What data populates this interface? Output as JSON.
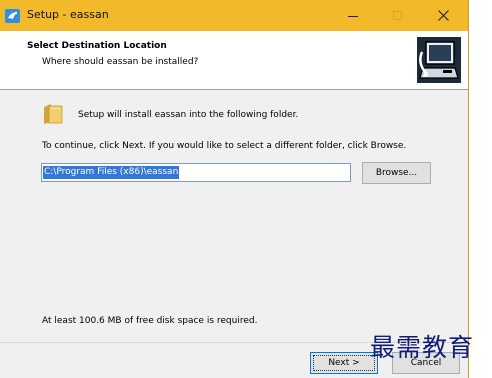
{
  "window": {
    "title": "Setup - eassan",
    "icon": "setup-app-icon",
    "controls": {
      "minimize": "minimize-icon",
      "maximize": "maximize-icon",
      "close": "close-icon"
    }
  },
  "header": {
    "title": "Select Destination Location",
    "subtitle": "Where should eassan be installed?",
    "image": "installer-computer-icon"
  },
  "body": {
    "folder_icon": "folder-icon",
    "intro": "Setup will install eassan into the following folder.",
    "instruction": "To continue, click Next. If you would like to select a different folder, click Browse.",
    "path_value": "C:\\Program Files (x86)\\eassan",
    "browse_label": "Browse...",
    "disk_space": "At least 100.6 MB of free disk space is required."
  },
  "footer": {
    "next_label": "Next >",
    "cancel_label": "Cancel"
  },
  "watermark": "最需教育",
  "colors": {
    "titlebar": "#f2b92b",
    "selection": "#3378d5",
    "watermark": "#141c78"
  }
}
